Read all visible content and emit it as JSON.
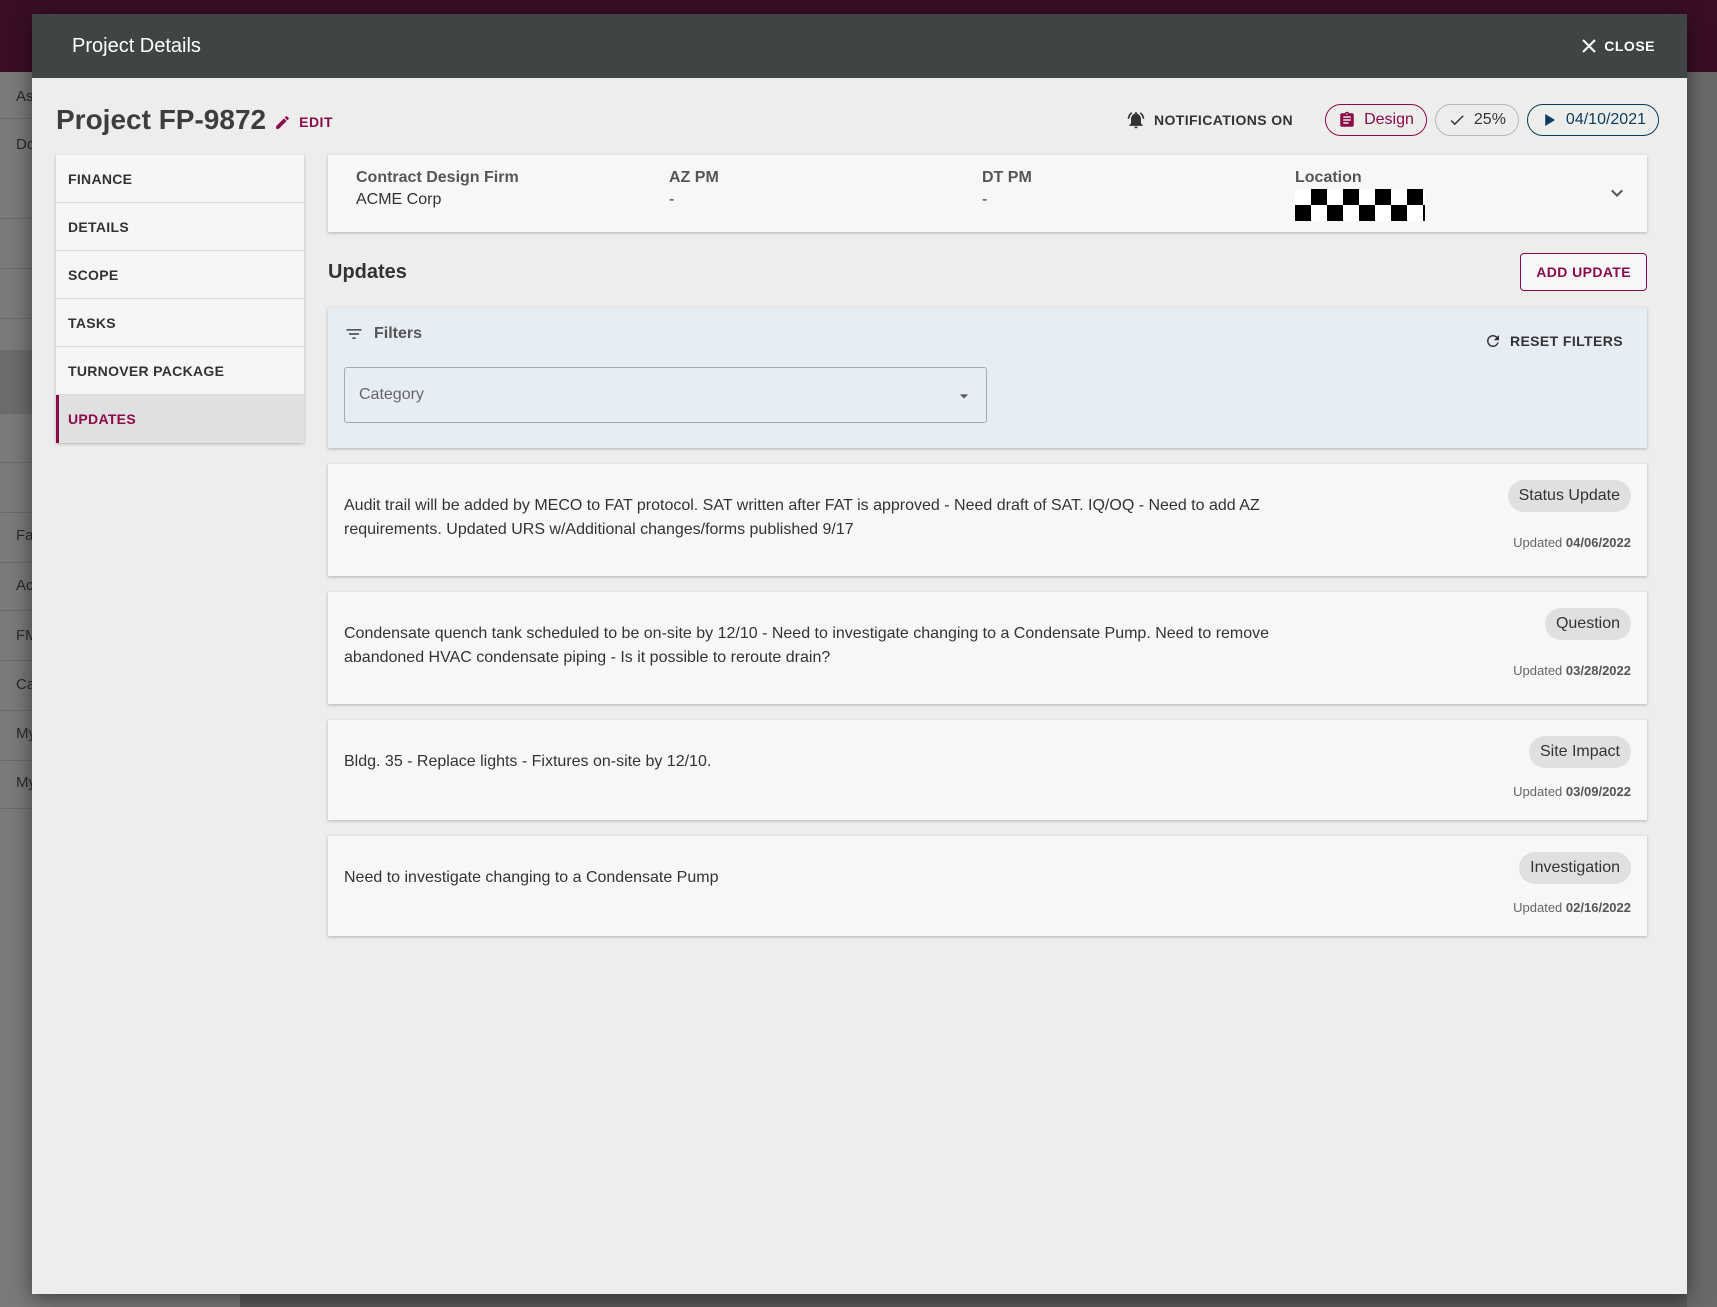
{
  "background": {
    "left_items": [
      "As",
      "Do",
      "Fa",
      "Ac",
      "FM",
      "Ca",
      "My",
      "My"
    ]
  },
  "modal": {
    "title": "Project Details",
    "close_label": "CLOSE"
  },
  "project": {
    "title": "Project FP-9872",
    "edit_label": "EDIT",
    "notifications_label": "NOTIFICATIONS ON",
    "phase": "Design",
    "progress": "25%",
    "date": "04/10/2021"
  },
  "nav": {
    "items": [
      "FINANCE",
      "DETAILS",
      "SCOPE",
      "TASKS",
      "TURNOVER PACKAGE",
      "UPDATES"
    ],
    "active": "UPDATES"
  },
  "info": {
    "contract_design_firm_label": "Contract Design Firm",
    "contract_design_firm_value": "ACME Corp",
    "az_pm_label": "AZ PM",
    "az_pm_value": "-",
    "dt_pm_label": "DT PM",
    "dt_pm_value": "-",
    "location_label": "Location"
  },
  "updates": {
    "title": "Updates",
    "add_label": "ADD UPDATE",
    "filters_label": "Filters",
    "reset_label": "RESET FILTERS",
    "category_placeholder": "Category",
    "updated_prefix": "Updated",
    "items": [
      {
        "text": "Audit trail will be added by MECO to FAT protocol. SAT written after FAT is approved - Need draft of SAT. IQ/OQ - Need to add AZ requirements. Updated URS w/Additional changes/forms published 9/17",
        "category": "Status Update",
        "date": "04/06/2022"
      },
      {
        "text": "Condensate quench tank scheduled to be on-site by 12/10 - Need to investigate changing to a Condensate Pump. Need to remove abandoned HVAC condensate piping - Is it possible to reroute drain?",
        "category": "Question",
        "date": "03/28/2022"
      },
      {
        "text": "Bldg. 35 - Replace lights - Fixtures on-site by 12/10.",
        "category": "Site Impact",
        "date": "03/09/2022"
      },
      {
        "text": "Need to investigate changing to a Condensate Pump",
        "category": "Investigation",
        "date": "02/16/2022"
      }
    ]
  },
  "colors": {
    "accent": "#8a0a4a",
    "header_bg": "#3f4545",
    "date_chip": "#0d3b5e",
    "filters_bg": "#e6edf5"
  }
}
